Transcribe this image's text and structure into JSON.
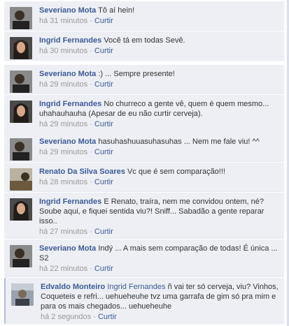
{
  "comments": [
    {
      "author": "Severiano Mota",
      "mention": "",
      "text": "Tô aí hein!",
      "time": "há 31 minutos",
      "like": "Curtir",
      "avatar": "avatar-severiano"
    },
    {
      "author": "Ingrid Fernandes",
      "mention": "",
      "text": "Você tá em todas Sevê.",
      "time": "há 30 minutos",
      "like": "Curtir",
      "avatar": "avatar-ingrid"
    },
    {
      "author": "Severiano Mota",
      "mention": "",
      "text": ":) ... Sempre presente!",
      "time": "há 29 minutos",
      "like": "Curtir",
      "avatar": "avatar-severiano"
    },
    {
      "author": "Ingrid Fernandes",
      "mention": "",
      "text": "No churreco a gente vê, quem é quem mesmo... uhahauhauha (Apesar de eu não curtir cerveja).",
      "time": "há 29 minutos",
      "like": "Curtir",
      "avatar": "avatar-ingrid"
    },
    {
      "author": "Severiano Mota",
      "mention": "",
      "text": "hasuhashuuasuhasuhas ... Nem me fale viu! ^^",
      "time": "há 29 minutos",
      "like": "Curtir",
      "avatar": "avatar-severiano"
    },
    {
      "author": "Renato Da Silva Soares",
      "mention": "",
      "text": "Vc que é sem comparação!!!",
      "time": "há 28 minutos",
      "like": "Curtir",
      "avatar": "avatar-renato"
    },
    {
      "author": "Ingrid Fernandes",
      "mention": "",
      "text": "E Renato, traíra, nem me convidou ontem, né? Soube aqui, e fiquei sentida viu?! Sniff... Sabadão a gente reparar isso..",
      "time": "há 27 minutos",
      "like": "Curtir",
      "avatar": "avatar-ingrid"
    },
    {
      "author": "Severiano Mota",
      "mention": "",
      "text": "Indý ... A mais sem comparação de todas! É única ... S2",
      "time": "há 22 minutos",
      "like": "Curtir",
      "avatar": "avatar-severiano"
    },
    {
      "author": "Edvaldo Monteiro",
      "mention": "Ingrid Fernandes",
      "text": "ñ vai ter só cerveja, viu? Vinhos, Coqueteis e refri... uehueheuhe tvz uma garrafa de gim só pra mim e para os mais chegados... uehueheuhe",
      "time": "há 2 segundos",
      "like": "Curtir",
      "avatar": "avatar-edvaldo"
    }
  ],
  "colors": {
    "link": "#3b5998",
    "background": "#edeff4",
    "meta": "#999999"
  }
}
